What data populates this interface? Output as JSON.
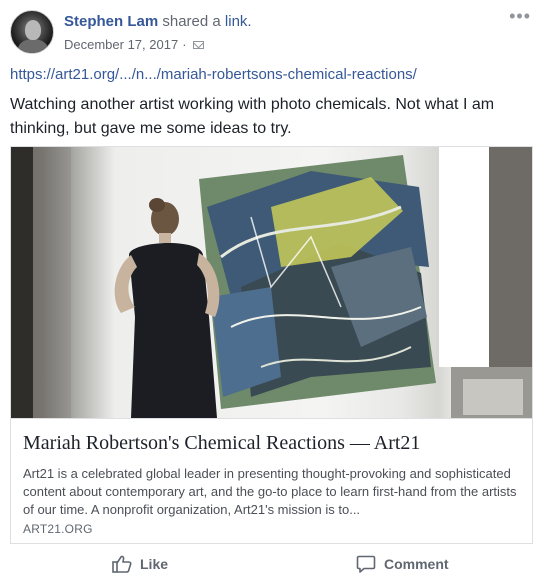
{
  "post": {
    "author": "Stephen Lam",
    "action_text": "shared a",
    "action_link": "link.",
    "date": "December 17, 2017",
    "separator": "·",
    "shared_url": "https://art21.org/.../n.../mariah-robertsons-chemical-reactions/",
    "text": "Watching another artist working with photo chemicals. Not what I am thinking, but gave me some ideas to try."
  },
  "attachment": {
    "title": "Mariah Robertson's Chemical Reactions — Art21",
    "description": "Art21 is a celebrated global leader in presenting thought-provoking and sophisticated content about contemporary art, and the go-to place to learn first-hand from the artists of our time. A nonprofit organization, Art21's mission is to...",
    "domain": "ART21.ORG"
  },
  "actions": {
    "like_label": "Like",
    "comment_label": "Comment"
  },
  "icons": {
    "more": "more-options-icon",
    "audience": "audience-icon",
    "like": "thumbs-up-icon",
    "comment": "comment-bubble-icon"
  },
  "colors": {
    "link": "#365899",
    "secondary_text": "#616770",
    "primary_text": "#1d2129",
    "border": "#dddfe2"
  }
}
